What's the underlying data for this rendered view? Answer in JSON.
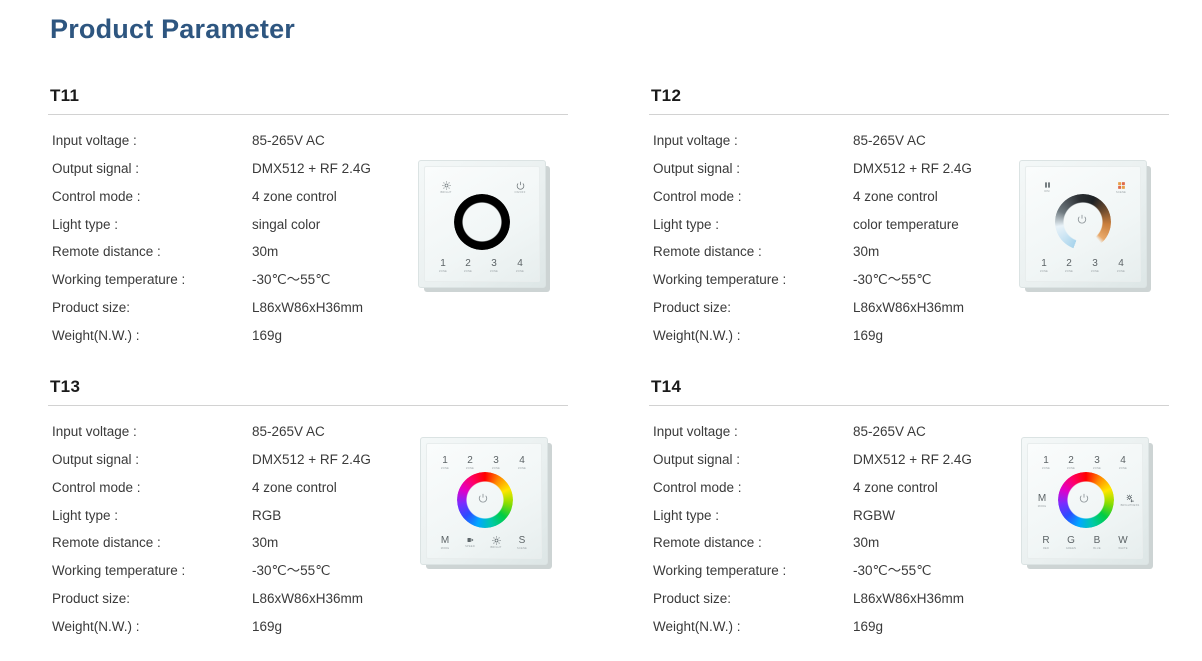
{
  "page": {
    "title": "Product Parameter",
    "title_color": "#2e5680"
  },
  "spec_labels": {
    "input_voltage": "Input voltage :",
    "output_signal": "Output signal :",
    "control_mode": "Control mode :",
    "light_type": "Light type :",
    "remote_distance": "Remote distance :",
    "working_temperature": "Working temperature :",
    "product_size": "Product size:",
    "weight": "Weight(N.W.) :"
  },
  "products": [
    {
      "model": "T11",
      "input_voltage": "85-265V AC",
      "output_signal": "DMX512 + RF 2.4G",
      "control_mode": "4 zone control",
      "light_type": "singal color",
      "remote_distance": "30m",
      "working_temperature": "-30℃～55℃",
      "product_size": "L86xW86xH36mm",
      "weight": "169g",
      "panel": {
        "ring_style": "monochrome-gradient",
        "top_left_icon": "brightness-icon",
        "top_left_label": "BRIGHT",
        "top_right_icon": "power-icon",
        "top_right_label": "ON/OFF",
        "zones": [
          "1",
          "2",
          "3",
          "4"
        ],
        "zone_sub": "ZONE",
        "zones_position": "bottom"
      }
    },
    {
      "model": "T12",
      "input_voltage": "85-265V AC",
      "output_signal": "DMX512 + RF 2.4G",
      "control_mode": "4 zone control",
      "light_type": "color temperature",
      "remote_distance": "30m",
      "working_temperature": "-30℃～55℃",
      "product_size": "L86xW86xH36mm",
      "weight": "169g",
      "panel": {
        "ring_style": "color-temperature-gradient",
        "top_left_icon": "dimmer-icon",
        "top_left_label": "DIM",
        "top_right_icon": "scene-icon",
        "top_right_label": "SCENE",
        "center_icon": "power-icon",
        "zones": [
          "1",
          "2",
          "3",
          "4"
        ],
        "zone_sub": "ZONE",
        "zones_position": "bottom"
      }
    },
    {
      "model": "T13",
      "input_voltage": "85-265V AC",
      "output_signal": "DMX512 + RF 2.4G",
      "control_mode": "4 zone control",
      "light_type": "RGB",
      "remote_distance": "30m",
      "working_temperature": "-30℃～55℃",
      "product_size": "L86xW86xH36mm",
      "weight": "169g",
      "panel": {
        "ring_style": "rgb-color-wheel",
        "center_icon": "power-icon",
        "zones": [
          "1",
          "2",
          "3",
          "4"
        ],
        "zone_sub": "ZONE",
        "zones_position": "top",
        "bottom_buttons": [
          {
            "label": "M",
            "sub": "MODE",
            "icon": "mode-icon"
          },
          {
            "label": "",
            "sub": "SPEED",
            "icon": "speed-icon"
          },
          {
            "label": "",
            "sub": "BRIGHT",
            "icon": "brightness-icon"
          },
          {
            "label": "S",
            "sub": "SCENE",
            "icon": "scene-icon"
          }
        ]
      }
    },
    {
      "model": "T14",
      "input_voltage": "85-265V AC",
      "output_signal": "DMX512 + RF 2.4G",
      "control_mode": "4 zone control",
      "light_type": "RGBW",
      "remote_distance": "30m",
      "working_temperature": "-30℃～55℃",
      "product_size": "L86xW86xH36mm",
      "weight": "169g",
      "panel": {
        "ring_style": "rgb-color-wheel",
        "center_icon": "power-icon",
        "zones": [
          "1",
          "2",
          "3",
          "4"
        ],
        "zone_sub": "ZONE",
        "zones_position": "top",
        "left_button": {
          "label": "M",
          "sub": "MODE",
          "icon": "mode-icon"
        },
        "right_button": {
          "label": "",
          "sub": "BRIGHTNESS",
          "icon": "brightness-icon"
        },
        "bottom_buttons": [
          {
            "label": "R",
            "sub": "RED"
          },
          {
            "label": "G",
            "sub": "GREEN"
          },
          {
            "label": "B",
            "sub": "BLUE"
          },
          {
            "label": "W",
            "sub": "WHITE"
          }
        ]
      }
    }
  ]
}
